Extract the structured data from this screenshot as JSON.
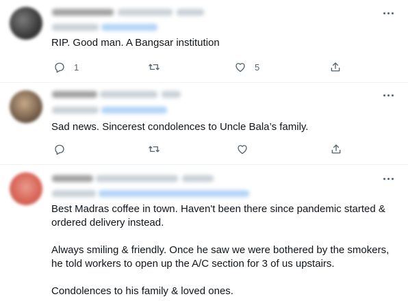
{
  "tweets": [
    {
      "id": "t1",
      "text_lines": [
        "RIP. Good man. A Bangsar institution"
      ],
      "reply_count": "1",
      "retweet_count": "",
      "like_count": "5"
    },
    {
      "id": "t2",
      "text_lines": [
        "Sad news. Sincerest condolences to Uncle Bala’s family."
      ],
      "reply_count": "",
      "retweet_count": "",
      "like_count": ""
    },
    {
      "id": "t3",
      "paragraphs": [
        "Best Madras coffee in town. Haven't been there since pandemic started & ordered delivery instead.",
        "Always smiling & friendly. Once he saw we were bothered by the smokers, he told workers to open up the A/C section for 3 of us upstairs.",
        "Condolences to his family & loved ones."
      ]
    }
  ],
  "icons": {
    "more": "more-options-icon",
    "reply": "reply-icon",
    "retweet": "retweet-icon",
    "like": "like-icon",
    "share": "share-icon"
  },
  "colors": {
    "text": "#0f1419",
    "secondary": "#536471",
    "link": "#1d9bf0",
    "divider": "#eff3f4"
  }
}
